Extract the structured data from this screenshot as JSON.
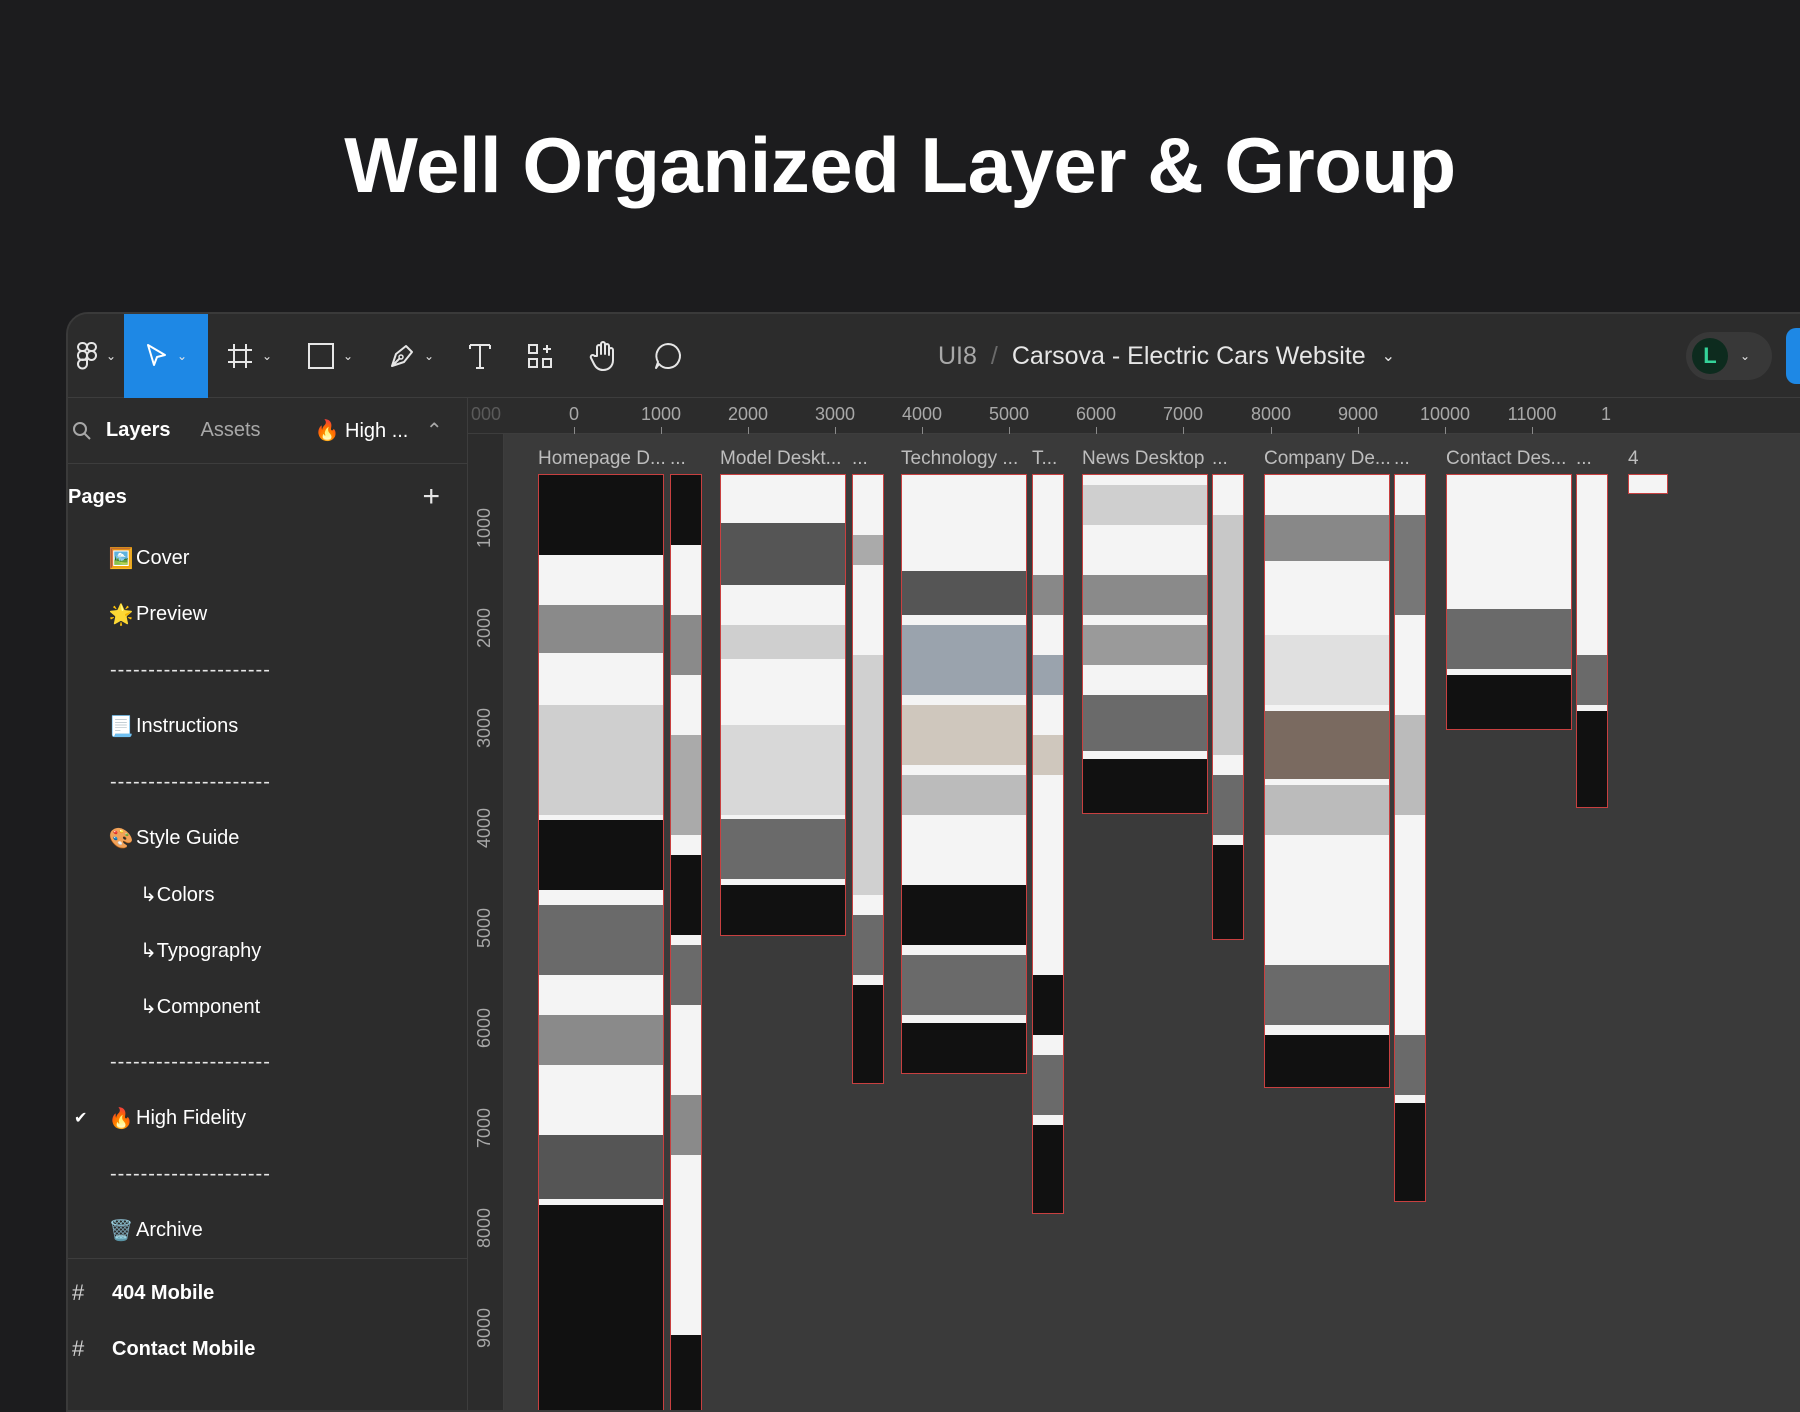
{
  "headline": "Well Organized Layer & Group",
  "toolbar": {
    "project": "UI8",
    "separator": "/",
    "file_name": "Carsova - Electric Cars Website",
    "avatar_letter": "L"
  },
  "sidebar": {
    "tabs": [
      "Layers",
      "Assets"
    ],
    "current_page": "High ...",
    "pages_title": "Pages",
    "pages": [
      {
        "icon": "🖼️",
        "label": "Cover"
      },
      {
        "icon": "🌟",
        "label": "Preview"
      },
      {
        "icon": "",
        "label": "---------------------"
      },
      {
        "icon": "📃",
        "label": "Instructions"
      },
      {
        "icon": "",
        "label": "---------------------"
      },
      {
        "icon": "🎨",
        "label": "Style Guide"
      },
      {
        "icon": "",
        "label": "↳Colors"
      },
      {
        "icon": "",
        "label": "↳Typography"
      },
      {
        "icon": "",
        "label": "↳Component"
      },
      {
        "icon": "",
        "label": "---------------------"
      },
      {
        "icon": "🔥",
        "label": "High Fidelity"
      },
      {
        "icon": "",
        "label": "---------------------"
      },
      {
        "icon": "🗑️",
        "label": "Archive"
      }
    ],
    "frames": [
      "404 Mobile",
      "Contact Mobile"
    ]
  },
  "ruler": {
    "top": [
      "000",
      "0",
      "1000",
      "2000",
      "3000",
      "4000",
      "5000",
      "6000",
      "7000",
      "8000",
      "9000",
      "10000",
      "11000",
      "1"
    ],
    "left": [
      "1000",
      "2000",
      "3000",
      "4000",
      "5000",
      "6000",
      "7000",
      "8000",
      "9000"
    ]
  },
  "canvas": {
    "frame_labels": [
      "Homepage D...",
      "...",
      "Model Deskt...",
      "...",
      "Technology ...",
      "T...",
      "News Desktop",
      "...",
      "Company De...",
      "...",
      "Contact Des...",
      "...",
      "4"
    ]
  }
}
